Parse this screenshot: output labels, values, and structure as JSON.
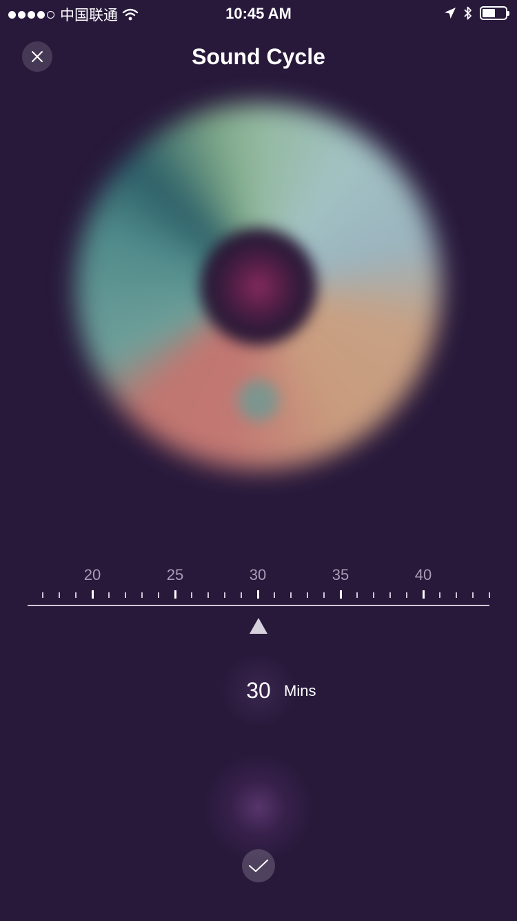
{
  "status_bar": {
    "carrier": "中国联通",
    "time": "10:45 AM",
    "signal_bars_filled": 4,
    "signal_bars_total": 5,
    "battery_level": 0.55
  },
  "header": {
    "title": "Sound Cycle",
    "close_icon": "close-icon"
  },
  "timer": {
    "ruler_labels": [
      "20",
      "25",
      "30",
      "35",
      "40"
    ],
    "ruler_min": 16,
    "ruler_max": 44,
    "selected_value": "30",
    "unit": "Mins"
  },
  "actions": {
    "confirm_icon": "checkmark-icon"
  },
  "colors": {
    "background": "#28193b",
    "text": "#ffffff",
    "ruler_label": "#a99db5"
  }
}
